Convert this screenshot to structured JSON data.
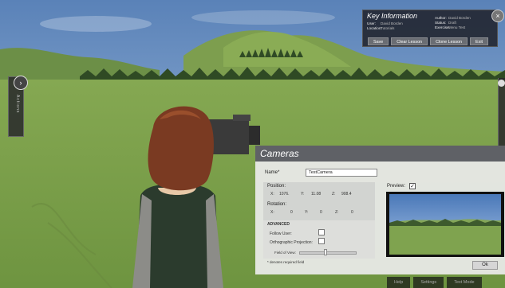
{
  "key_info": {
    "title": "Key Information",
    "user_label": "User:",
    "user_value": "David Borden",
    "location_label": "Location:",
    "location_value": "Tutorials",
    "author_label": "Author:",
    "author_value": "David Borden",
    "status_label": "Status:",
    "status_value": "Draft",
    "exercise_label": "Exercise:",
    "exercise_value": "Menu Test",
    "buttons": [
      "Save",
      "Clear Lesson",
      "Clone Lesson",
      "Exit"
    ],
    "close_glyph": "×"
  },
  "side_panel": {
    "label": "Actions",
    "arrow_glyph": "›"
  },
  "camera_panel": {
    "title": "Cameras",
    "name_label": "Name*",
    "name_value": "TestCamera",
    "position_label": "Position:",
    "position": {
      "x_label": "X:",
      "x": "1076.",
      "y_label": "Y:",
      "y": "11.08",
      "z_label": "Z:",
      "z": "908.4"
    },
    "rotation_label": "Rotation:",
    "rotation": {
      "x_label": "X:",
      "x": "0",
      "y_label": "Y:",
      "y": "0",
      "z_label": "Z:",
      "z": "0"
    },
    "advanced_label": "ADVANCED",
    "follow_user_label": "Follow User:",
    "ortho_label": "Orthographic Projection:",
    "fov_label": "Field of View:",
    "fov_fraction": 0.46,
    "required_note": "* denotes required field",
    "preview_label": "Preview:",
    "preview_checked_glyph": "✓",
    "ok_label": "Ok"
  },
  "bottom_buttons": [
    "Help",
    "Settings",
    "Text Mode"
  ],
  "colors": {
    "sky": "#6a8fbd",
    "grass": "#7aa04c",
    "panel_header": "#5f6166",
    "panel_body": "#ebebeb"
  },
  "icons": {
    "close": "close-icon",
    "expand": "chevron-right-icon",
    "checkbox": "checkbox-icon"
  }
}
